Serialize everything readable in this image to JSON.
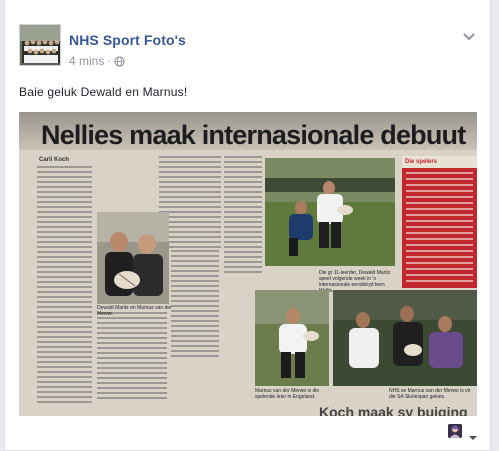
{
  "post": {
    "page_name": "NHS Sport Foto's",
    "timestamp": "4 mins",
    "separator": "·",
    "privacy_icon": "globe-icon",
    "text": "Baie geluk Dewald en Marnus!"
  },
  "article": {
    "headline": "Nellies maak internasionale debuut",
    "byline": "Carli Koch",
    "sidebar_title": "Die spelers",
    "caption_left": "Dewald Maritz en Marnus van der Merwe.",
    "caption_right": "Die gr 11-leerder, Dewald Maritz speel volgende week in 'n internasionale eendstryd teen Wallis.",
    "caption_bottom_left": "Marnus van der Merwe is die spelende leier in Engeland.",
    "caption_bottom_right": "NHS se Marnus van der Merwe is vir die SA Skolespan gekies.",
    "bottom_headline": "Koch maak sy buiging"
  },
  "colors": {
    "link": "#365899",
    "meta": "#90949c",
    "sidebar_red": "#c1272d"
  }
}
